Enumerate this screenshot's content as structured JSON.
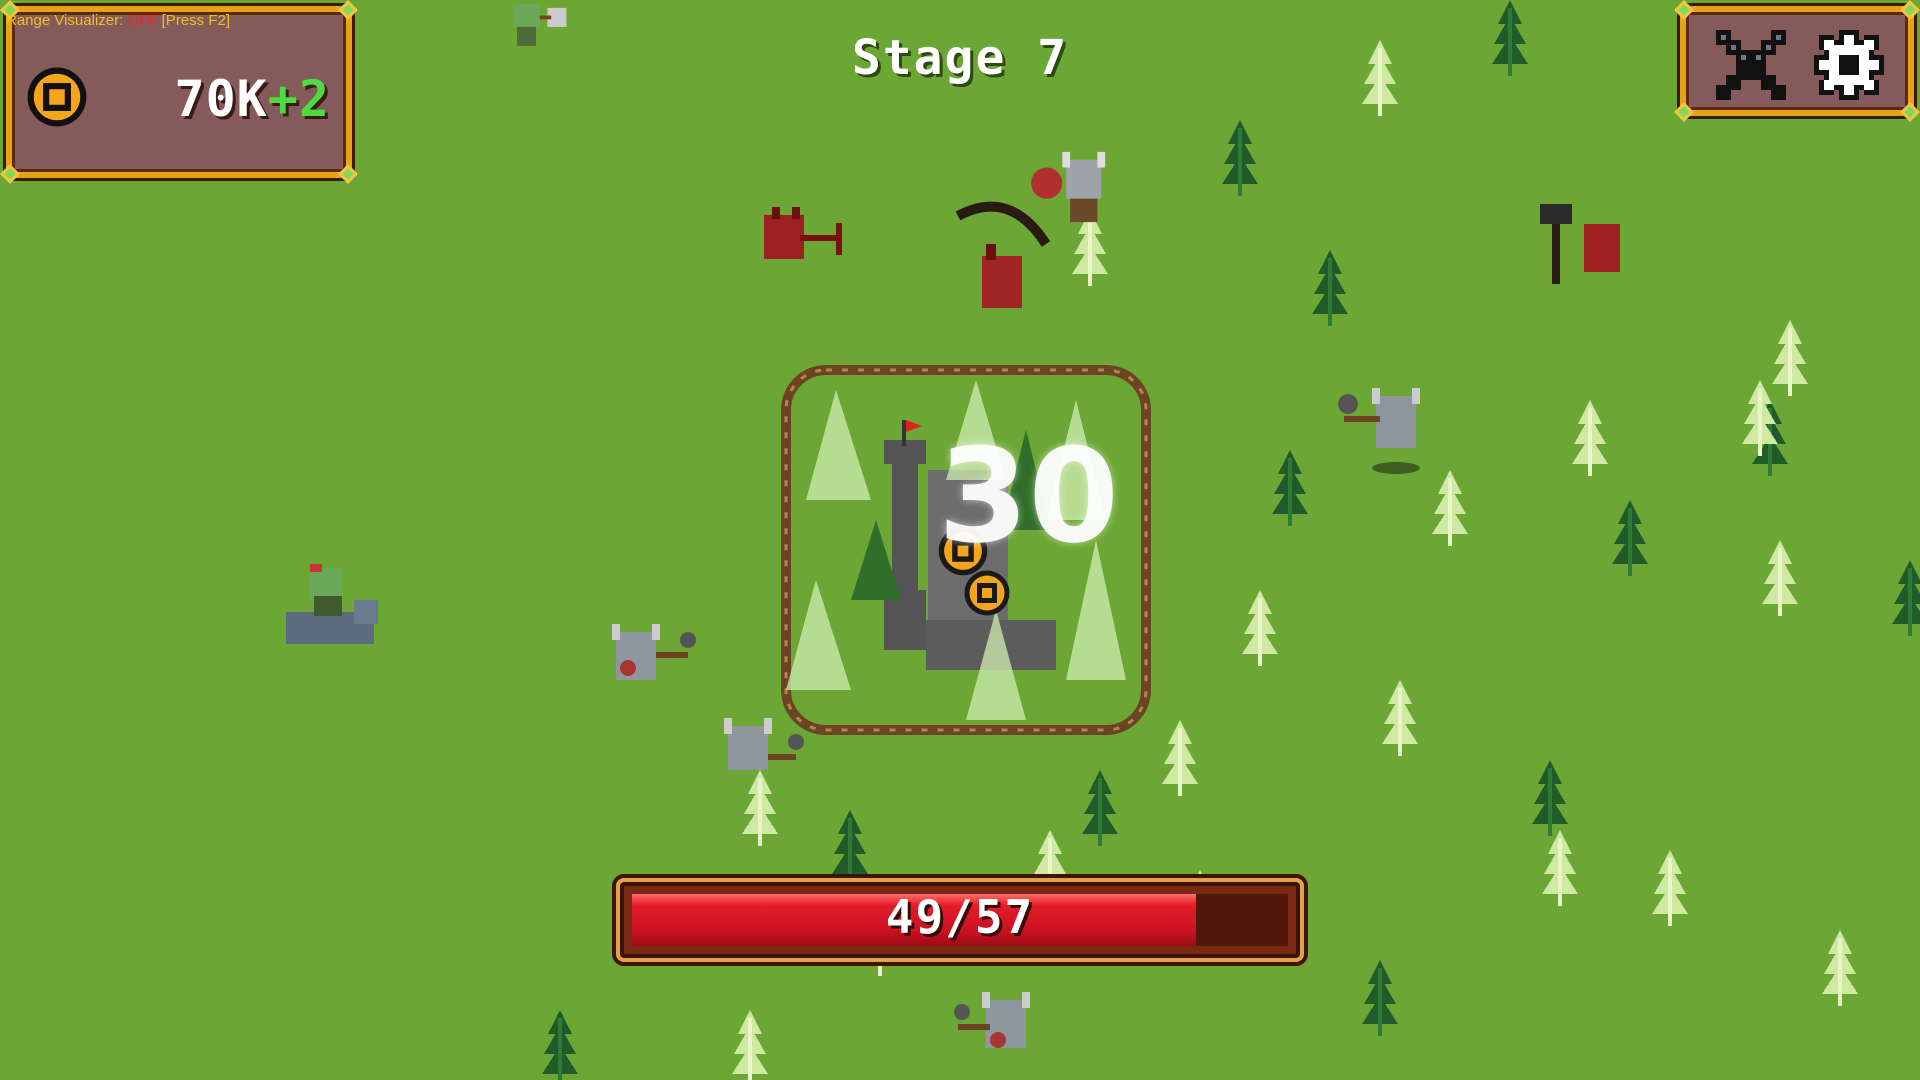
{
  "hud": {
    "range_visualizer": {
      "label": "Range Visualizer:",
      "state": "OFF",
      "hint": "[Press F2]"
    },
    "currency": {
      "amount": "70K",
      "gain": "+2",
      "icon": "coin-icon"
    },
    "stage_title": "Stage 7",
    "menu": {
      "battle_icon": "crossed-swords-icon",
      "settings_icon": "gear-icon"
    }
  },
  "combat": {
    "damage_number": "30",
    "base_health": {
      "current": 49,
      "max": 57,
      "label": "49/57"
    }
  },
  "colors": {
    "grass": "#6ca634",
    "panel_bg": "#845a5a",
    "panel_border": "#e7a21a",
    "hp_fill": "#e21d27",
    "gain_text": "#4ddc3e",
    "range_off": "#ff2020",
    "range_label": "#f0c020"
  }
}
